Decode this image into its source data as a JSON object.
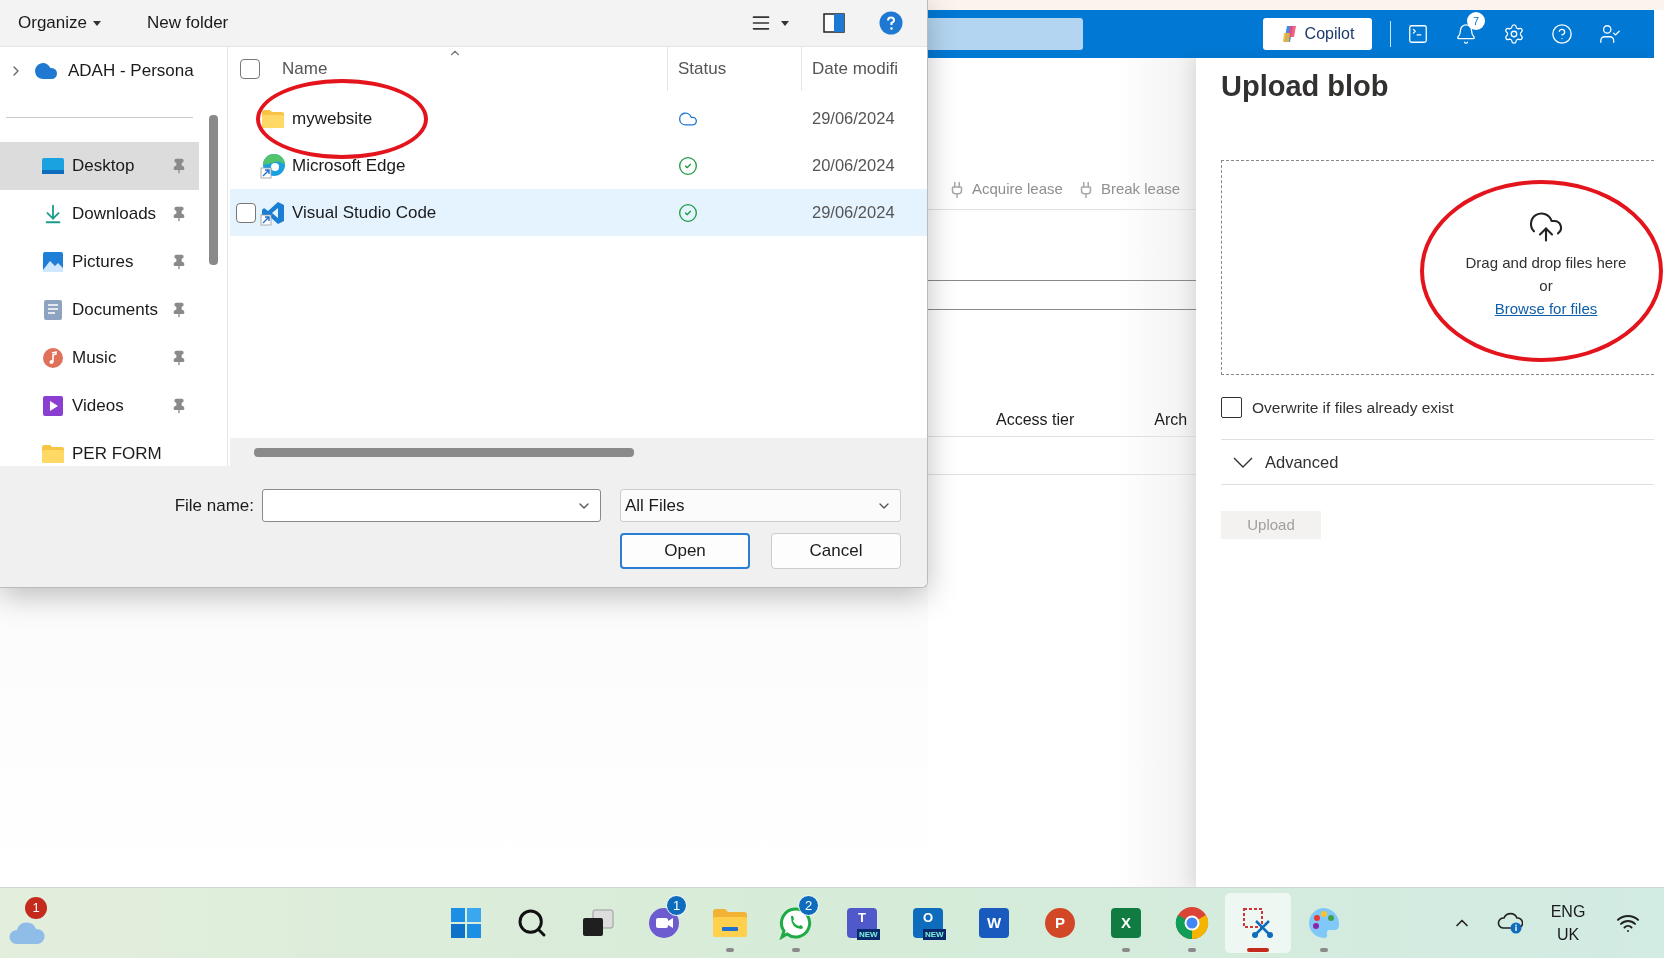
{
  "file_dialog": {
    "toolbar": {
      "organize": "Organize",
      "new_folder": "New folder"
    },
    "nav_root": {
      "label": "ADAH - Persona",
      "expanded": false
    },
    "nav_items": [
      {
        "label": "Desktop",
        "kind": "desktop",
        "selected": true,
        "pinned": true
      },
      {
        "label": "Downloads",
        "kind": "downloads",
        "selected": false,
        "pinned": true
      },
      {
        "label": "Pictures",
        "kind": "pictures",
        "selected": false,
        "pinned": true
      },
      {
        "label": "Documents",
        "kind": "documents",
        "selected": false,
        "pinned": true
      },
      {
        "label": "Music",
        "kind": "music",
        "selected": false,
        "pinned": true
      },
      {
        "label": "Videos",
        "kind": "videos",
        "selected": false,
        "pinned": true
      },
      {
        "label": "PER FORM",
        "kind": "folder",
        "selected": false,
        "pinned": false
      }
    ],
    "all_selected": false,
    "columns": [
      "Name",
      "Status",
      "Date modifi"
    ],
    "files": [
      {
        "name": "mywebsite",
        "kind": "folder",
        "available_offline": false,
        "date": "29/06/2024",
        "hovered": false,
        "circled": true
      },
      {
        "name": "Microsoft Edge",
        "kind": "edge",
        "available_offline": true,
        "date": "20/06/2024",
        "hovered": false,
        "circled": false
      },
      {
        "name": "Visual Studio Code",
        "kind": "vscode",
        "available_offline": true,
        "date": "29/06/2024",
        "hovered": true,
        "circled": false
      }
    ],
    "file_name_label": "File name:",
    "file_type": "All Files",
    "buttons": [
      {
        "label": "Open",
        "kind": "primary"
      },
      {
        "label": "Cancel",
        "kind": "secondary"
      }
    ]
  },
  "portal": {
    "copilot": "Copilot",
    "notification_count": "7",
    "commands": [
      {
        "label": "Acquire lease"
      },
      {
        "label": "Break lease"
      }
    ],
    "columns": [
      "Access tier",
      "Arch"
    ]
  },
  "upload_panel": {
    "title": "Upload blob",
    "drop_text": "Drag and drop files here",
    "or": "or",
    "browse": "Browse for files",
    "circled": true,
    "overwrite": {
      "label": "Overwrite if files already exist",
      "checked": false
    },
    "advanced": {
      "label": "Advanced",
      "expanded": false
    },
    "upload": {
      "label": "Upload",
      "disabled": true
    }
  },
  "taskbar": {
    "weather_badge": "1",
    "apps": [
      {
        "kind": "start",
        "running": false,
        "active": false
      },
      {
        "kind": "search",
        "running": false,
        "active": false
      },
      {
        "kind": "taskview",
        "running": false,
        "active": false
      },
      {
        "kind": "meet",
        "badge": "1",
        "running": false,
        "active": false
      },
      {
        "kind": "explorer",
        "running": true,
        "active": false
      },
      {
        "kind": "whatsapp",
        "badge": "2",
        "running": true,
        "active": false
      },
      {
        "kind": "teams",
        "glyph": "T",
        "tag": "NEW",
        "running": false,
        "active": false
      },
      {
        "kind": "outlook",
        "glyph": "O",
        "tag": "NEW",
        "running": false,
        "active": false
      },
      {
        "kind": "word",
        "glyph": "W",
        "running": false,
        "active": false
      },
      {
        "kind": "powerpoint",
        "glyph": "P",
        "running": false,
        "active": false
      },
      {
        "kind": "excel",
        "glyph": "X",
        "running": true,
        "active": false
      },
      {
        "kind": "chrome",
        "running": true,
        "active": false
      },
      {
        "kind": "snipping",
        "running": true,
        "active": true
      },
      {
        "kind": "paint",
        "running": true,
        "active": false
      }
    ],
    "tray": {
      "language": "ENG",
      "region": "UK"
    }
  }
}
